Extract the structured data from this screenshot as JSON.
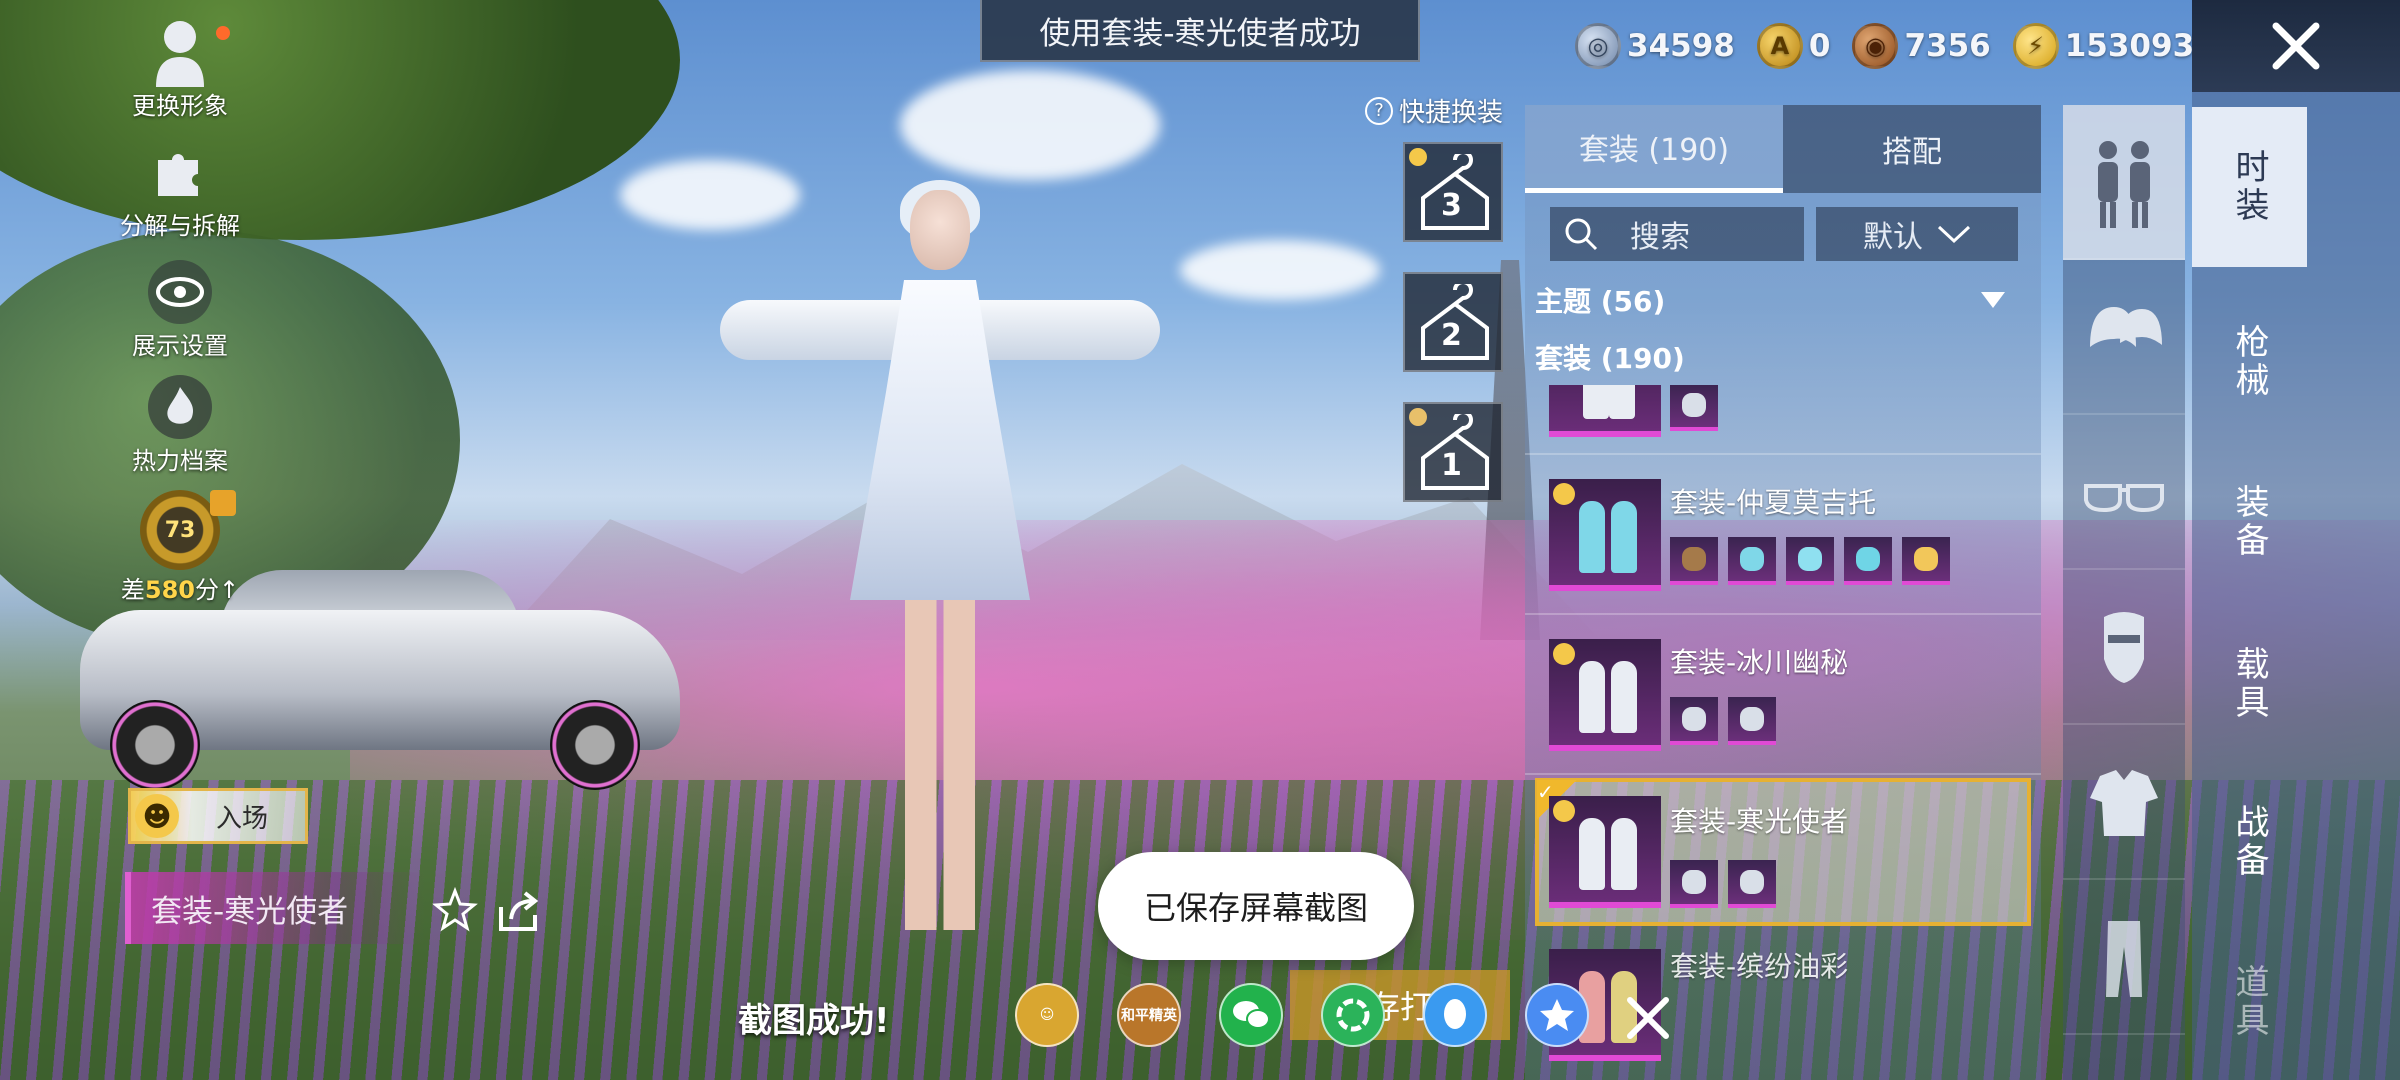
{
  "top_toast": "使用套装-寒光使者成功",
  "currencies": [
    {
      "icon": "silver-coin-icon",
      "value": "34598",
      "symbol": "◎"
    },
    {
      "icon": "gold-emblem-icon",
      "value": "0",
      "symbol": "A"
    },
    {
      "icon": "bronze-coin-icon",
      "value": "7356",
      "symbol": "◉"
    },
    {
      "icon": "bolt-coin-icon",
      "value": "153093",
      "symbol": "⚡"
    }
  ],
  "left_menu": {
    "change_avatar": "更换形象",
    "decompose": "分解与拆解",
    "display_settings": "展示设置",
    "heat_profile": "热力档案",
    "level": "73",
    "diff_prefix": "差",
    "diff_value": "580",
    "diff_suffix": "分↑"
  },
  "enter_button": "入场",
  "outfit_name": "套装-寒光使者",
  "quick_change": {
    "title": "快捷换装",
    "help": "?",
    "slots": [
      "3",
      "2",
      "1"
    ]
  },
  "panel": {
    "tab_sets": "套装 (190)",
    "tab_match": "搭配",
    "search": "搜索",
    "sort": "默认",
    "theme": "主题 (56)",
    "sets": "套装 (190)",
    "items": [
      {
        "name": "",
        "chips": 1
      },
      {
        "name": "套装-仲夏莫吉托",
        "chips": 5
      },
      {
        "name": "套装-冰川幽秘",
        "chips": 2
      },
      {
        "name": "套装-寒光使者",
        "chips": 2,
        "selected": true
      },
      {
        "name": "套装-缤纷油彩",
        "chips": 0
      }
    ]
  },
  "nav": [
    "时装",
    "枪械",
    "装备",
    "载具",
    "战备",
    "道具"
  ],
  "screenshot": {
    "saved_toast": "已保存屏幕截图",
    "success": "截图成功!",
    "hidden_button": "存打",
    "share_icons": [
      {
        "name": "profile-share-icon",
        "label": "",
        "color": "#d9a630"
      },
      {
        "name": "peace-elite-share-icon",
        "label": "和平精英",
        "color": "#b9762a"
      },
      {
        "name": "wechat-icon",
        "label": "",
        "color": "#22b24c"
      },
      {
        "name": "moments-icon",
        "label": "",
        "color": "#2bb35a"
      },
      {
        "name": "qq-icon",
        "label": "",
        "color": "#3a9af0"
      },
      {
        "name": "qzone-icon",
        "label": "",
        "color": "#4a8cf2"
      }
    ]
  }
}
